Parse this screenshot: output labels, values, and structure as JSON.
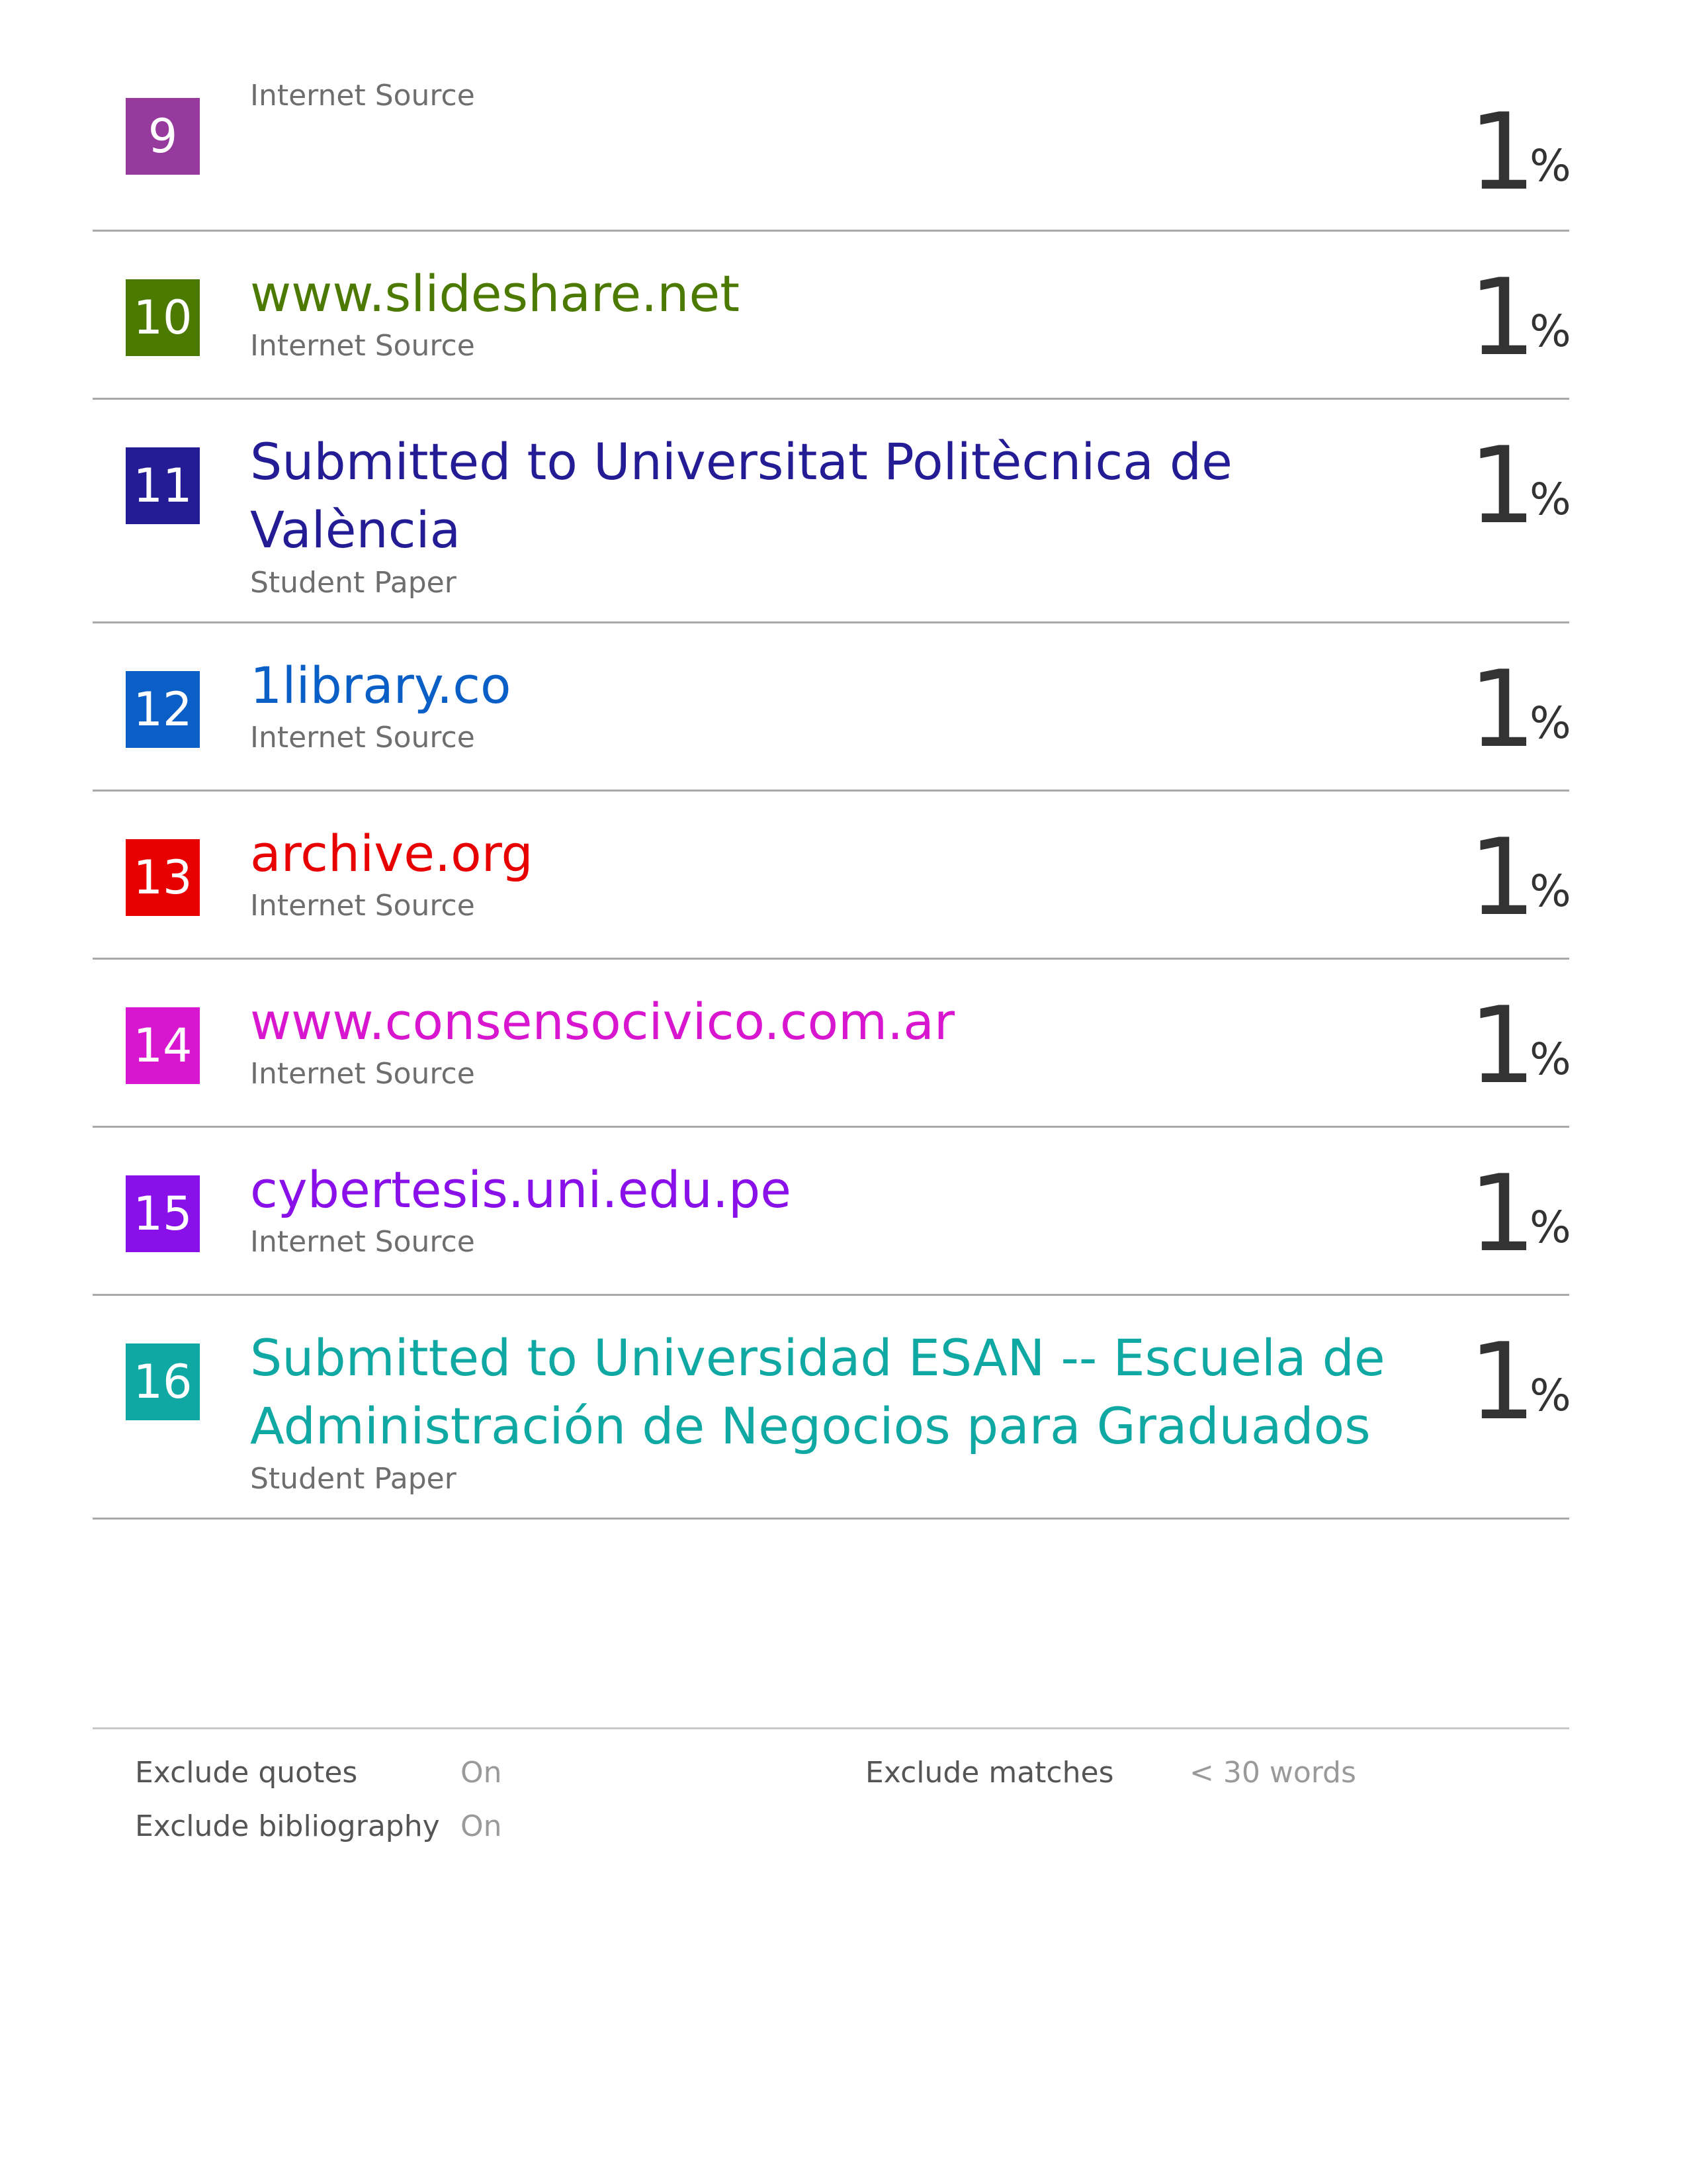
{
  "sources": [
    {
      "number": "9",
      "name": "",
      "type": "Internet Source",
      "percent": "1",
      "percent_sign": "%",
      "color": "#973a9d"
    },
    {
      "number": "10",
      "name": "www.slideshare.net",
      "type": "Internet Source",
      "percent": "1",
      "percent_sign": "%",
      "color": "#4c7a00"
    },
    {
      "number": "11",
      "name": "Submitted to Universitat Politècnica de\nValència",
      "type": "Student Paper",
      "percent": "1",
      "percent_sign": "%",
      "color": "#241c94"
    },
    {
      "number": "12",
      "name": "1library.co",
      "type": "Internet Source",
      "percent": "1",
      "percent_sign": "%",
      "color": "#0a5fc6"
    },
    {
      "number": "13",
      "name": "archive.org",
      "type": "Internet Source",
      "percent": "1",
      "percent_sign": "%",
      "color": "#e80000"
    },
    {
      "number": "14",
      "name": "www.consensocivico.com.ar",
      "type": "Internet Source",
      "percent": "1",
      "percent_sign": "%",
      "color": "#d916cf"
    },
    {
      "number": "15",
      "name": "cybertesis.uni.edu.pe",
      "type": "Internet Source",
      "percent": "1",
      "percent_sign": "%",
      "color": "#8a10ea"
    },
    {
      "number": "16",
      "name": "Submitted to Universidad ESAN -- Escuela de\nAdministración de Negocios para Graduados",
      "type": "Student Paper",
      "percent": "1",
      "percent_sign": "%",
      "color": "#0fa8a3"
    }
  ],
  "footer": {
    "exclude_quotes_label": "Exclude quotes",
    "exclude_quotes_value": "On",
    "exclude_bibliography_label": "Exclude bibliography",
    "exclude_bibliography_value": "On",
    "exclude_matches_label": "Exclude matches",
    "exclude_matches_value": "< 30 words"
  }
}
